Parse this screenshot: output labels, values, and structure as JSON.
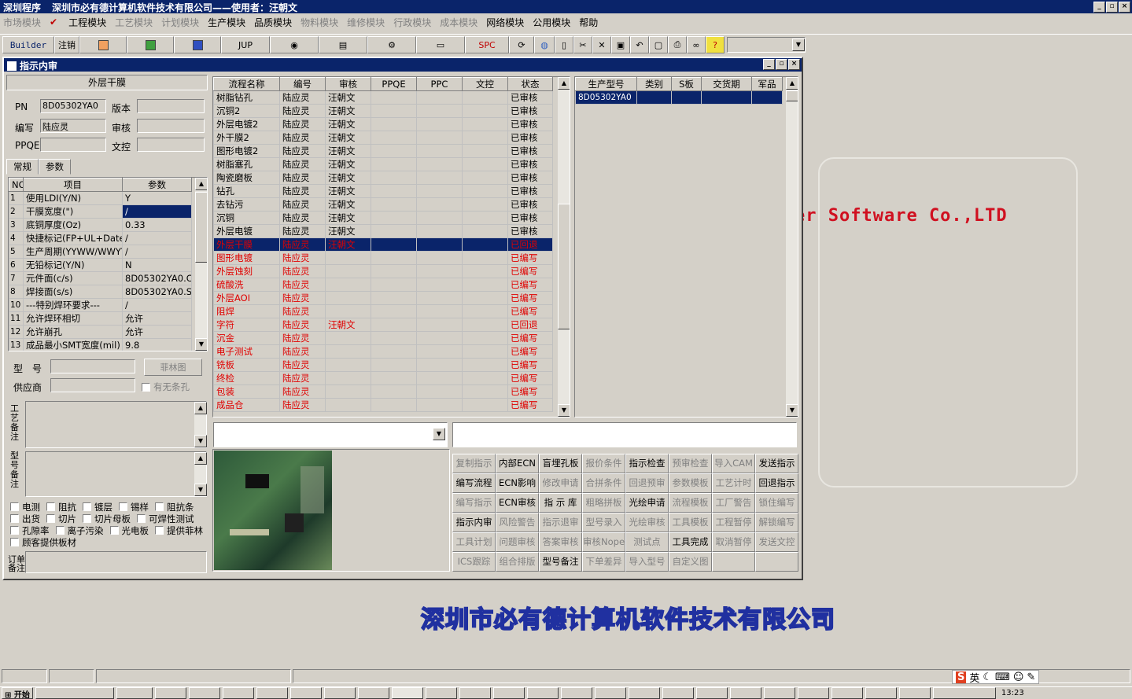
{
  "app": {
    "title": "深圳程序",
    "subtitle": "深圳市必有德计算机软件技术有限公司——使用者：汪朝文"
  },
  "sysbtns": [
    "_",
    "▫",
    "×"
  ],
  "menu": [
    {
      "label": "市场模块",
      "enabled": false
    },
    {
      "label": "工程模块",
      "enabled": true,
      "checked": true
    },
    {
      "label": "工艺模块",
      "enabled": false
    },
    {
      "label": "计划模块",
      "enabled": false
    },
    {
      "label": "生产模块",
      "enabled": true
    },
    {
      "label": "品质模块",
      "enabled": true
    },
    {
      "label": "物料模块",
      "enabled": false
    },
    {
      "label": "维修模块",
      "enabled": false
    },
    {
      "label": "行政模块",
      "enabled": false
    },
    {
      "label": "成本模块",
      "enabled": false
    },
    {
      "label": "网络模块",
      "enabled": true
    },
    {
      "label": "公用模块",
      "enabled": true
    },
    {
      "label": "帮助",
      "enabled": true
    }
  ],
  "toolbar": {
    "builder": "Builder",
    "logout": "注销",
    "jup": "JUP",
    "spc": "SPC"
  },
  "window": {
    "title": "指示内审"
  },
  "left": {
    "header": "外层干膜",
    "pn_label": "PN",
    "pn_value": "8D05302YA0",
    "version_label": "版本",
    "writer_label": "编写",
    "writer_value": "陆应灵",
    "review_label": "审核",
    "ppqe_label": "PPQE",
    "doc_label": "文控",
    "tab_general": "常规",
    "tab_params": "参数",
    "param_headers": [
      "NO",
      "项目",
      "参数"
    ],
    "params": [
      [
        "1",
        "使用LDI(Y/N)",
        "Y"
      ],
      [
        "2",
        "干膜宽度(\")",
        "/"
      ],
      [
        "3",
        "底铜厚度(Oz)",
        "0.33"
      ],
      [
        "4",
        "快捷标记(FP+UL+DateC",
        "/"
      ],
      [
        "5",
        "生产周期(YYWW/WWYY)",
        "/"
      ],
      [
        "6",
        "无铅标记(Y/N)",
        "N"
      ],
      [
        "7",
        "元件面(c/s)",
        "8D05302YA0.CS"
      ],
      [
        "8",
        "焊接面(s/s)",
        "8D05302YA0.SS"
      ],
      [
        "10",
        "---特别焊环要求---",
        "/"
      ],
      [
        "11",
        "允许焊环相切",
        "允许"
      ],
      [
        "12",
        "允许崩孔",
        "允许"
      ],
      [
        "13",
        "成品最小SMT宽度(mil)",
        "9.8"
      ]
    ],
    "model_label": "型　号",
    "film_button": "菲林图",
    "supplier_label": "供应商",
    "has_strip_label": "有无条孔",
    "process_note_label": "工艺备注",
    "model_note_label": "型号备注",
    "checks": [
      [
        "电测",
        "阻抗",
        "镀层",
        "锡样",
        "阻抗条"
      ],
      [
        "出货",
        "切片",
        "切片母板",
        "可焊性测试"
      ],
      [
        "孔隙率",
        "离子污染",
        "光电板",
        "提供菲林"
      ],
      [
        "顾客提供板材"
      ]
    ],
    "order_note_label": "订单备注"
  },
  "process_table": {
    "headers": [
      "流程名称",
      "编号",
      "审核",
      "PPQE",
      "PPC",
      "文控",
      "状态"
    ],
    "rows": [
      {
        "name": "树脂钻孔",
        "code": "陆应灵",
        "review": "汪朝文",
        "status": "已审核",
        "style": "normal"
      },
      {
        "name": "沉铜2",
        "code": "陆应灵",
        "review": "汪朝文",
        "status": "已审核",
        "style": "normal"
      },
      {
        "name": "外层电镀2",
        "code": "陆应灵",
        "review": "汪朝文",
        "status": "已审核",
        "style": "normal"
      },
      {
        "name": "外干膜2",
        "code": "陆应灵",
        "review": "汪朝文",
        "status": "已审核",
        "style": "normal"
      },
      {
        "name": "图形电镀2",
        "code": "陆应灵",
        "review": "汪朝文",
        "status": "已审核",
        "style": "normal"
      },
      {
        "name": "树脂塞孔",
        "code": "陆应灵",
        "review": "汪朝文",
        "status": "已审核",
        "style": "normal"
      },
      {
        "name": "陶瓷磨板",
        "code": "陆应灵",
        "review": "汪朝文",
        "status": "已审核",
        "style": "normal"
      },
      {
        "name": "钻孔",
        "code": "陆应灵",
        "review": "汪朝文",
        "status": "已审核",
        "style": "normal"
      },
      {
        "name": "去钻污",
        "code": "陆应灵",
        "review": "汪朝文",
        "status": "已审核",
        "style": "normal"
      },
      {
        "name": "沉铜",
        "code": "陆应灵",
        "review": "汪朝文",
        "status": "已审核",
        "style": "normal"
      },
      {
        "name": "外层电镀",
        "code": "陆应灵",
        "review": "汪朝文",
        "status": "已审核",
        "style": "normal"
      },
      {
        "name": "外层干膜",
        "code": "陆应灵",
        "review": "汪朝文",
        "status": "已回退",
        "style": "selected"
      },
      {
        "name": "图形电镀",
        "code": "陆应灵",
        "review": "",
        "status": "已编写",
        "style": "red"
      },
      {
        "name": "外层蚀刻",
        "code": "陆应灵",
        "review": "",
        "status": "已编写",
        "style": "red"
      },
      {
        "name": "硫酸洗",
        "code": "陆应灵",
        "review": "",
        "status": "已编写",
        "style": "red"
      },
      {
        "name": "外层AOI",
        "code": "陆应灵",
        "review": "",
        "status": "已编写",
        "style": "red"
      },
      {
        "name": "阻焊",
        "code": "陆应灵",
        "review": "",
        "status": "已编写",
        "style": "red"
      },
      {
        "name": "字符",
        "code": "陆应灵",
        "review": "汪朝文",
        "status": "已回退",
        "style": "red"
      },
      {
        "name": "沉金",
        "code": "陆应灵",
        "review": "",
        "status": "已编写",
        "style": "red"
      },
      {
        "name": "电子测试",
        "code": "陆应灵",
        "review": "",
        "status": "已编写",
        "style": "red"
      },
      {
        "name": "铣板",
        "code": "陆应灵",
        "review": "",
        "status": "已编写",
        "style": "red"
      },
      {
        "name": "终检",
        "code": "陆应灵",
        "review": "",
        "status": "已编写",
        "style": "red"
      },
      {
        "name": "包装",
        "code": "陆应灵",
        "review": "",
        "status": "已编写",
        "style": "red"
      },
      {
        "name": "成品仓",
        "code": "陆应灵",
        "review": "",
        "status": "已编写",
        "style": "red"
      }
    ]
  },
  "product_table": {
    "headers": [
      "生产型号",
      "类别",
      "S板",
      "交货期",
      "军品"
    ],
    "rows": [
      [
        "8D05302YA0",
        "",
        "",
        "",
        ""
      ]
    ]
  },
  "buttons": [
    {
      "label": "复制指示",
      "enabled": false
    },
    {
      "label": "内部ECN",
      "enabled": true
    },
    {
      "label": "盲埋孔板",
      "enabled": true
    },
    {
      "label": "报价条件",
      "enabled": false
    },
    {
      "label": "指示检查",
      "enabled": true
    },
    {
      "label": "预审检查",
      "enabled": false
    },
    {
      "label": "导入CAM",
      "enabled": false
    },
    {
      "label": "发送指示",
      "enabled": true
    },
    {
      "label": "编写流程",
      "enabled": true
    },
    {
      "label": "ECN影响",
      "enabled": true
    },
    {
      "label": "修改申请",
      "enabled": false
    },
    {
      "label": "合拼条件",
      "enabled": false
    },
    {
      "label": "回退预审",
      "enabled": false
    },
    {
      "label": "参数模板",
      "enabled": false
    },
    {
      "label": "工艺计时",
      "enabled": false
    },
    {
      "label": "回退指示",
      "enabled": true
    },
    {
      "label": "编写指示",
      "enabled": false
    },
    {
      "label": "ECN审核",
      "enabled": true
    },
    {
      "label": "指 示 库",
      "enabled": true
    },
    {
      "label": "粗略拼板",
      "enabled": false
    },
    {
      "label": "光绘申请",
      "enabled": true
    },
    {
      "label": "流程模板",
      "enabled": false
    },
    {
      "label": "工厂警告",
      "enabled": false
    },
    {
      "label": "锁住编写",
      "enabled": false
    },
    {
      "label": "指示内审",
      "enabled": true
    },
    {
      "label": "风险警告",
      "enabled": false
    },
    {
      "label": "指示退审",
      "enabled": false
    },
    {
      "label": "型号录入",
      "enabled": false
    },
    {
      "label": "光绘审核",
      "enabled": false
    },
    {
      "label": "工具模板",
      "enabled": false
    },
    {
      "label": "工程暂停",
      "enabled": false
    },
    {
      "label": "解锁编写",
      "enabled": false
    },
    {
      "label": "工具计划",
      "enabled": false
    },
    {
      "label": "问题审核",
      "enabled": false
    },
    {
      "label": "答案审核",
      "enabled": false
    },
    {
      "label": "审核Nope",
      "enabled": false
    },
    {
      "label": "测试点",
      "enabled": false
    },
    {
      "label": "工具完成",
      "enabled": true
    },
    {
      "label": "取消暂停",
      "enabled": false
    },
    {
      "label": "发送文控",
      "enabled": false
    },
    {
      "label": "ICS跟踪",
      "enabled": false
    },
    {
      "label": "组合排版",
      "enabled": false
    },
    {
      "label": "型号备注",
      "enabled": true
    },
    {
      "label": "下单差异",
      "enabled": false
    },
    {
      "label": "导入型号",
      "enabled": false
    },
    {
      "label": "自定义图",
      "enabled": false
    },
    {
      "label": "",
      "enabled": false
    },
    {
      "label": "",
      "enabled": false
    }
  ],
  "desktop": {
    "banner": "er Software Co.,LTD",
    "company": "深圳市必有德计算机软件技术有限公司"
  },
  "taskbar": {
    "start": "开始",
    "clock": "13:23",
    "ime": "英"
  }
}
